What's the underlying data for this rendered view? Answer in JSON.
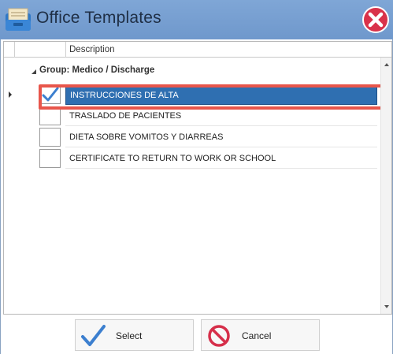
{
  "window": {
    "title": "Office Templates"
  },
  "grid": {
    "column_description": "Description",
    "group_label": "Group: Medico / Discharge",
    "rows": [
      {
        "label": "INSTRUCCIONES DE ALTA",
        "checked": true,
        "selected": true
      },
      {
        "label": "TRASLADO DE PACIENTES",
        "checked": false,
        "selected": false
      },
      {
        "label": "DIETA SOBRE VOMITOS Y DIARREAS",
        "checked": false,
        "selected": false
      },
      {
        "label": "CERTIFICATE TO RETURN TO WORK OR SCHOOL",
        "checked": false,
        "selected": false
      }
    ]
  },
  "buttons": {
    "select_label": "Select",
    "cancel_label": "Cancel"
  },
  "colors": {
    "titlebar": "#7fa6d6",
    "selection": "#2f6fb1",
    "highlight": "#e8564b",
    "check": "#3c7fcf",
    "cancel_icon": "#d62f4a"
  },
  "icons": {
    "app": "folder-tray-icon",
    "close": "close-icon",
    "select": "checkmark-icon",
    "cancel": "prohibited-icon"
  }
}
